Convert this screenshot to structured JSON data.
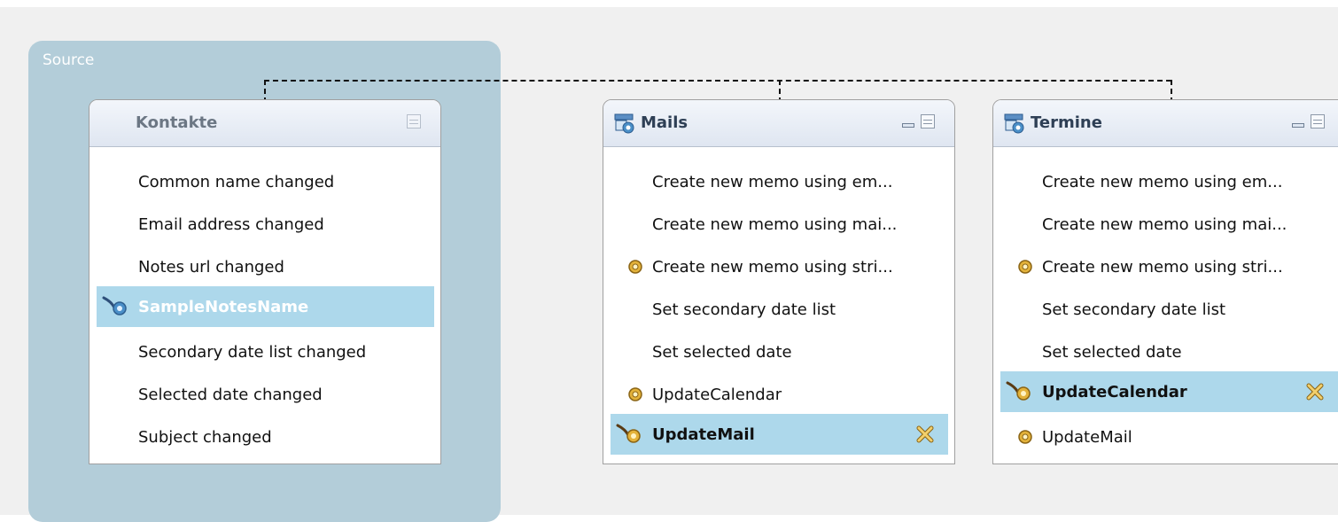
{
  "source_label": "Source",
  "colors": {
    "canvas_bg": "#f0f0f0",
    "source_group_bg": "#b3cdd9",
    "selected_row_bg": "#add8eb",
    "header_gradient_top": "#f3f6fb",
    "header_gradient_bottom": "#dfe6f1"
  },
  "kontakte": {
    "title": "Kontakte",
    "items": [
      {
        "label": "Common name changed"
      },
      {
        "label": "Email address changed"
      },
      {
        "label": "Notes url changed"
      },
      {
        "label": "SampleNotesName",
        "selected": true,
        "icon": "link-icon"
      },
      {
        "label": "Secondary date list changed"
      },
      {
        "label": "Selected date changed"
      },
      {
        "label": "Subject changed"
      }
    ]
  },
  "mails": {
    "title": "Mails",
    "header_icon": "form-icon",
    "items": [
      {
        "label": "Create new memo using em..."
      },
      {
        "label": "Create new memo using mai..."
      },
      {
        "label": "Create new memo using stri...",
        "icon": "bullet-icon"
      },
      {
        "label": "Set secondary date list"
      },
      {
        "label": "Set selected date"
      },
      {
        "label": "UpdateCalendar",
        "icon": "bullet-icon"
      },
      {
        "label": "UpdateMail",
        "selected": true,
        "icon": "link-icon",
        "action_icon": "remove-icon"
      }
    ]
  },
  "termine": {
    "title": "Termine",
    "header_icon": "form-icon",
    "items": [
      {
        "label": "Create new memo using em..."
      },
      {
        "label": "Create new memo using mai..."
      },
      {
        "label": "Create new memo using stri...",
        "icon": "bullet-icon"
      },
      {
        "label": "Set secondary date list"
      },
      {
        "label": "Set selected date"
      },
      {
        "label": "UpdateCalendar",
        "selected": true,
        "icon": "link-icon",
        "action_icon": "remove-icon"
      },
      {
        "label": "UpdateMail",
        "icon": "bullet-icon"
      }
    ]
  }
}
